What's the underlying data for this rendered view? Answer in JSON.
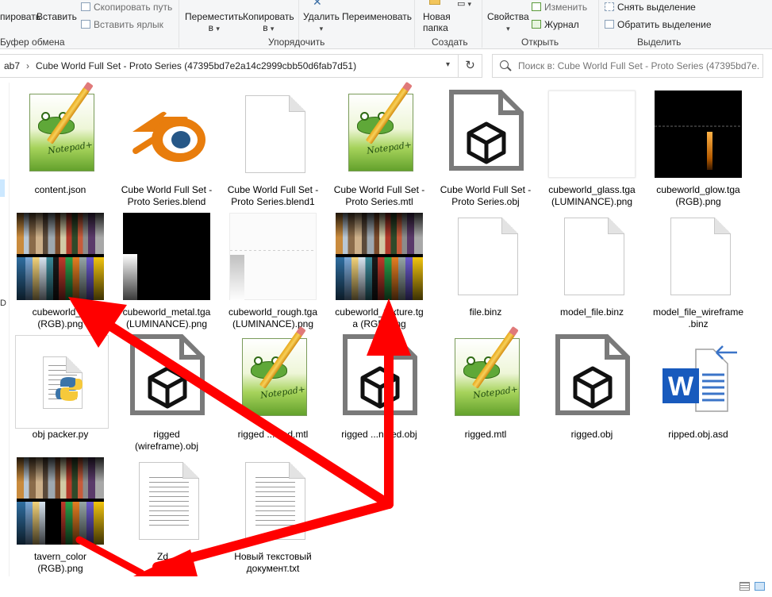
{
  "ribbon": {
    "clipboard": {
      "copy_partial": "пировать",
      "paste": "Вставить",
      "copy_path": "Скопировать путь",
      "paste_shortcut": "Вставить ярлык",
      "group": "Буфер обмена"
    },
    "organize": {
      "move_to": "Переместить",
      "move_to_sub": "в",
      "copy_to": "Копировать",
      "copy_to_sub": "в",
      "delete": "Удалить",
      "rename": "Переименовать",
      "group": "Упорядочить"
    },
    "new": {
      "new_folder": "Новая",
      "new_folder_sub": "папка",
      "group": "Создать"
    },
    "open": {
      "properties": "Свойства",
      "edit": "Изменить",
      "history": "Журнал",
      "group": "Открыть"
    },
    "select": {
      "select_none": "Снять выделение",
      "invert_selection": "Обратить выделение",
      "group": "Выделить"
    }
  },
  "address": {
    "crumb_prev": "ab7",
    "crumb_current": "Cube World Full Set - Proto Series (47395bd7e2a14c2999cbb50d6fab7d51)"
  },
  "search": {
    "placeholder": "Поиск в: Cube World Full Set - Proto Series (47395bd7e..."
  },
  "navpane": {
    "cut_label": "D"
  },
  "files": [
    {
      "name": "content.json",
      "type": "notepad-icon"
    },
    {
      "name": "Cube World Full Set - Proto Series.blend",
      "type": "blender-icon"
    },
    {
      "name": "Cube World Full Set - Proto Series.blend1",
      "type": "blank-file-icon"
    },
    {
      "name": "Cube World Full Set - Proto Series.mtl",
      "type": "notepad-icon"
    },
    {
      "name": "Cube World Full Set - Proto Series.obj",
      "type": "3d-object-icon"
    },
    {
      "name": "cubeworld_glass.tga (LUMINANCE).png",
      "type": "image-thumbnail"
    },
    {
      "name": "cubeworld_glow.tga (RGB).png",
      "type": "image-thumbnail"
    },
    {
      "name": "cubeworld_ju... (RGB).png",
      "type": "image-thumbnail"
    },
    {
      "name": "cubeworld_metal.tga (LUMINANCE).png",
      "type": "image-thumbnail"
    },
    {
      "name": "cubeworld_rough.tga (LUMINANCE).png",
      "type": "image-thumbnail"
    },
    {
      "name": "cubeworld_texture.tga (RGB).png",
      "type": "image-thumbnail"
    },
    {
      "name": "file.binz",
      "type": "blank-file-icon"
    },
    {
      "name": "model_file.binz",
      "type": "blank-file-icon"
    },
    {
      "name": "model_file_wireframe.binz",
      "type": "blank-file-icon"
    },
    {
      "name": "obj packer.py",
      "type": "python-file-icon"
    },
    {
      "name": "rigged (wireframe).obj",
      "type": "3d-object-icon"
    },
    {
      "name": "rigged ...dled.mtl",
      "type": "notepad-icon"
    },
    {
      "name": "rigged ...ndled.obj",
      "type": "3d-object-icon"
    },
    {
      "name": "rigged.mtl",
      "type": "notepad-icon"
    },
    {
      "name": "rigged.obj",
      "type": "3d-object-icon"
    },
    {
      "name": "ripped.obj.asd",
      "type": "word-document-icon"
    },
    {
      "name": "tavern_color... (RGB).png",
      "type": "image-thumbnail"
    },
    {
      "name": "Zd...",
      "type": "text-file-icon"
    },
    {
      "name": "Новый текстовый документ.txt",
      "type": "text-file-icon"
    }
  ],
  "labels": {
    "f0": "content.json",
    "f1a": "Cube World Full Set -",
    "f1b": "Proto Series.blend",
    "f2a": "Cube World Full Set -",
    "f2b": "Proto Series.blend1",
    "f3a": "Cube World Full Set -",
    "f3b": "Proto Series.mtl",
    "f4a": "Cube World Full Set -",
    "f4b": "Proto Series.obj",
    "f5a": "cubeworld_glass.tga",
    "f5b": "(LUMINANCE).png",
    "f6a": "cubeworld_glow.tga",
    "f6b": "(RGB).png",
    "f7a": "cubeworld_ju",
    "f7b": "(RGB).png",
    "f8a": "cubeworld_metal.tga",
    "f8b": "(LUMINANCE).png",
    "f9a": "cubeworld_rough.tga",
    "f9b": "(LUMINANCE).png",
    "f10a": "cubeworld_texture.tg",
    "f10b": "a (RGB).png",
    "f11": "file.binz",
    "f12": "model_file.binz",
    "f13a": "model_file_wireframe",
    "f13b": ".binz",
    "f14": "obj packer.py",
    "f15a": "rigged",
    "f15b": "(wireframe).obj",
    "f16": "rigged ...dled.mtl",
    "f17": "rigged ...ndled.obj",
    "f18": "rigged.mtl",
    "f19": "rigged.obj",
    "f20": "ripped.obj.asd",
    "f21a": "tavern_color",
    "f21b": "(RGB).png",
    "f22": "Zd...",
    "f23a": "Новый текстовый",
    "f23b": "документ.txt"
  },
  "icons": {
    "notepad_logo_text": "Notepad++",
    "word_letter": "W"
  },
  "colors": {
    "annotation_arrow": "#ff0000",
    "selection": "#cce8ff",
    "word_blue": "#185abd",
    "blender_orange": "#e87d0d",
    "blender_blue": "#265787"
  }
}
